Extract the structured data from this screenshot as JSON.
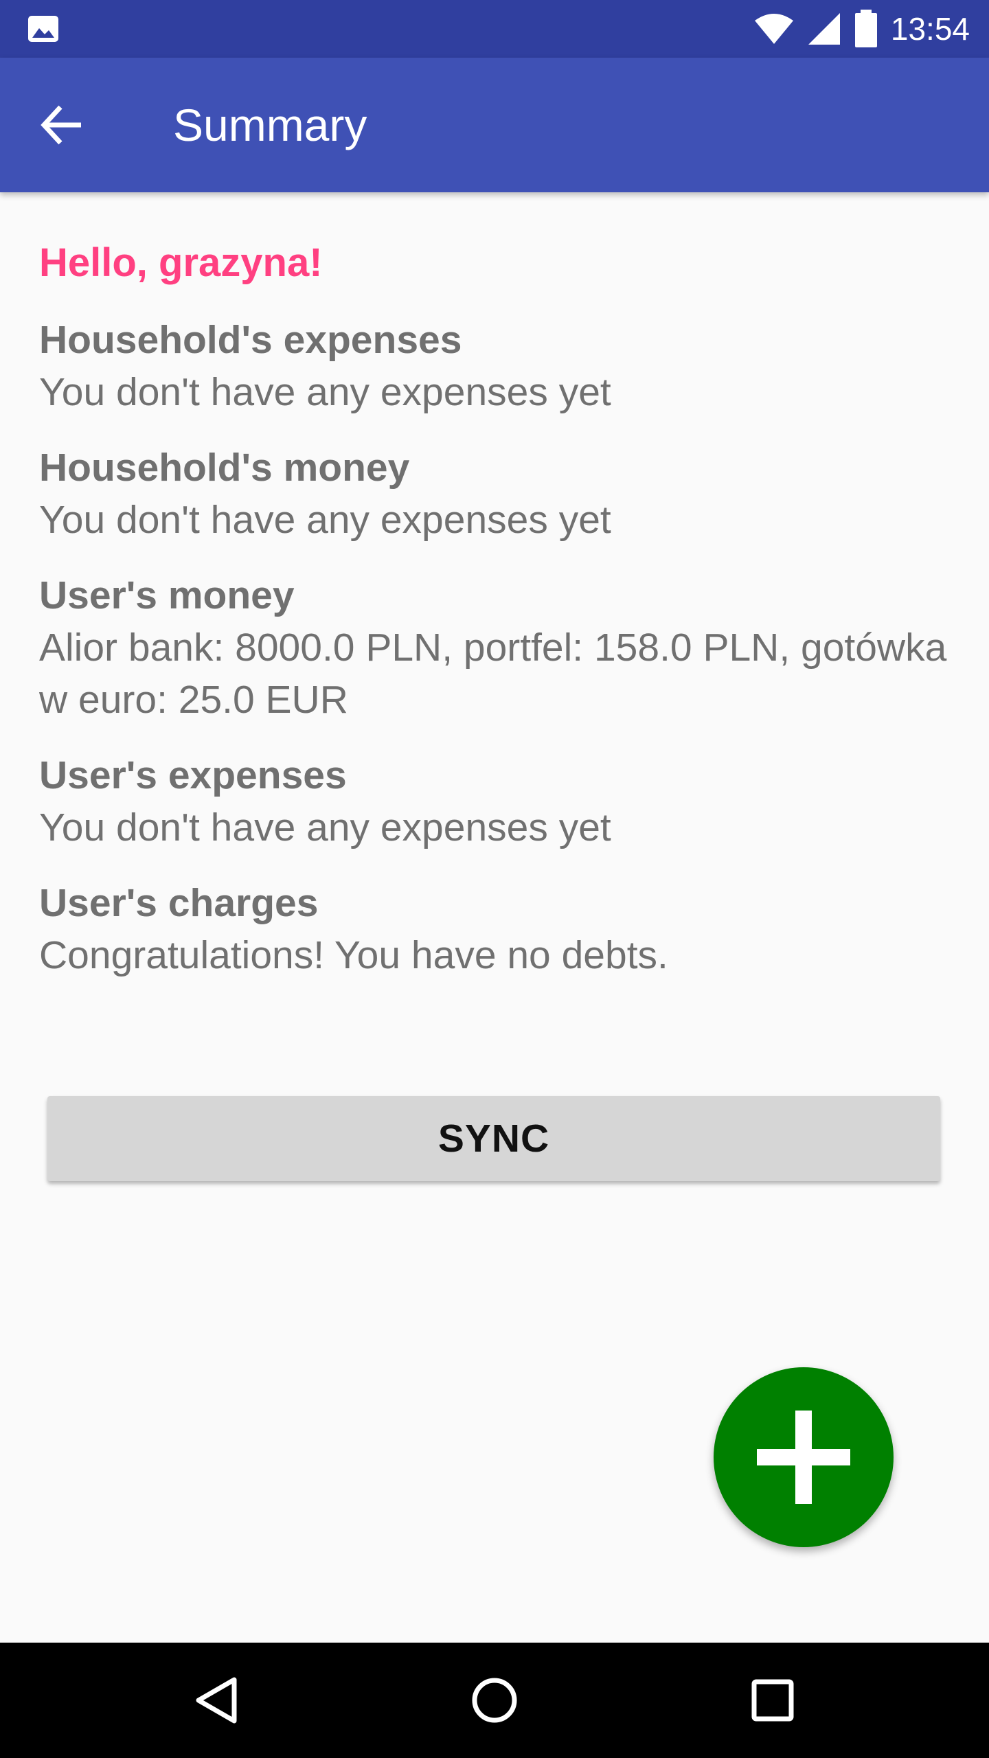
{
  "status_bar": {
    "time": "13:54",
    "icons": [
      "image-notification-icon",
      "wifi-icon",
      "signal-icon",
      "battery-icon"
    ]
  },
  "app_bar": {
    "title": "Summary",
    "back_icon": "arrow-back-icon",
    "background_color": "#3f51b5"
  },
  "greeting": "Hello, grazyna!",
  "sections": [
    {
      "title": "Household's expenses",
      "text": "You don't have any expenses yet"
    },
    {
      "title": "Household's money",
      "text": "You don't have any expenses yet"
    },
    {
      "title": "User's money",
      "text": "Alior bank: 8000.0 PLN, portfel: 158.0 PLN, gotówka w euro: 25.0 EUR"
    },
    {
      "title": "User's expenses",
      "text": "You don't have any expenses yet"
    },
    {
      "title": "User's charges",
      "text": "Congratulations! You have no debts."
    }
  ],
  "sync_button": {
    "label": "SYNC"
  },
  "fab": {
    "icon": "plus-icon",
    "color": "#008000"
  },
  "nav_bar": {
    "icons": [
      "back-triangle-icon",
      "home-circle-icon",
      "recents-square-icon"
    ]
  },
  "colors": {
    "status_bar": "#303f9f",
    "accent": "#ff4081",
    "text_secondary": "#707070"
  }
}
